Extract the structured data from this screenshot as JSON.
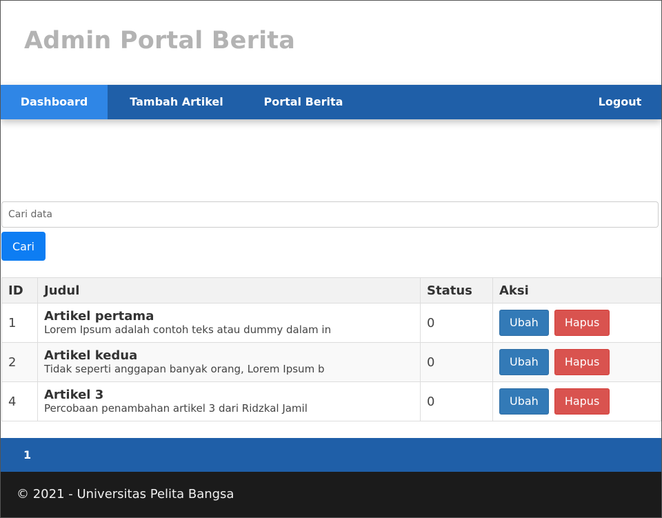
{
  "header": {
    "title": "Admin Portal Berita"
  },
  "nav": {
    "items": [
      {
        "label": "Dashboard",
        "active": true
      },
      {
        "label": "Tambah Artikel",
        "active": false
      },
      {
        "label": "Portal Berita",
        "active": false
      }
    ],
    "logout_label": "Logout"
  },
  "search": {
    "placeholder": "Cari data",
    "value": "",
    "button_label": "Cari"
  },
  "table": {
    "headers": [
      "ID",
      "Judul",
      "Status",
      "Aksi"
    ],
    "rows": [
      {
        "id": "1",
        "title": "Artikel pertama",
        "excerpt": "Lorem Ipsum adalah contoh teks atau dummy dalam in",
        "status": "0",
        "edit_label": "Ubah",
        "delete_label": "Hapus"
      },
      {
        "id": "2",
        "title": "Artikel kedua",
        "excerpt": "Tidak seperti anggapan banyak orang, Lorem Ipsum b",
        "status": "0",
        "edit_label": "Ubah",
        "delete_label": "Hapus"
      },
      {
        "id": "4",
        "title": "Artikel 3",
        "excerpt": "Percobaan penambahan artikel 3 dari Ridzkal Jamil",
        "status": "0",
        "edit_label": "Ubah",
        "delete_label": "Hapus"
      }
    ]
  },
  "pagination": {
    "pages": [
      "1"
    ]
  },
  "footer": {
    "text": "© 2021 - Universitas Pelita Bangsa"
  },
  "colors": {
    "nav": "#1f5fa8",
    "nav_active": "#2f86e6",
    "footer": "#1b1b1b",
    "edit": "#337ab7",
    "delete": "#d9534f",
    "search_button": "#0d7df3"
  }
}
